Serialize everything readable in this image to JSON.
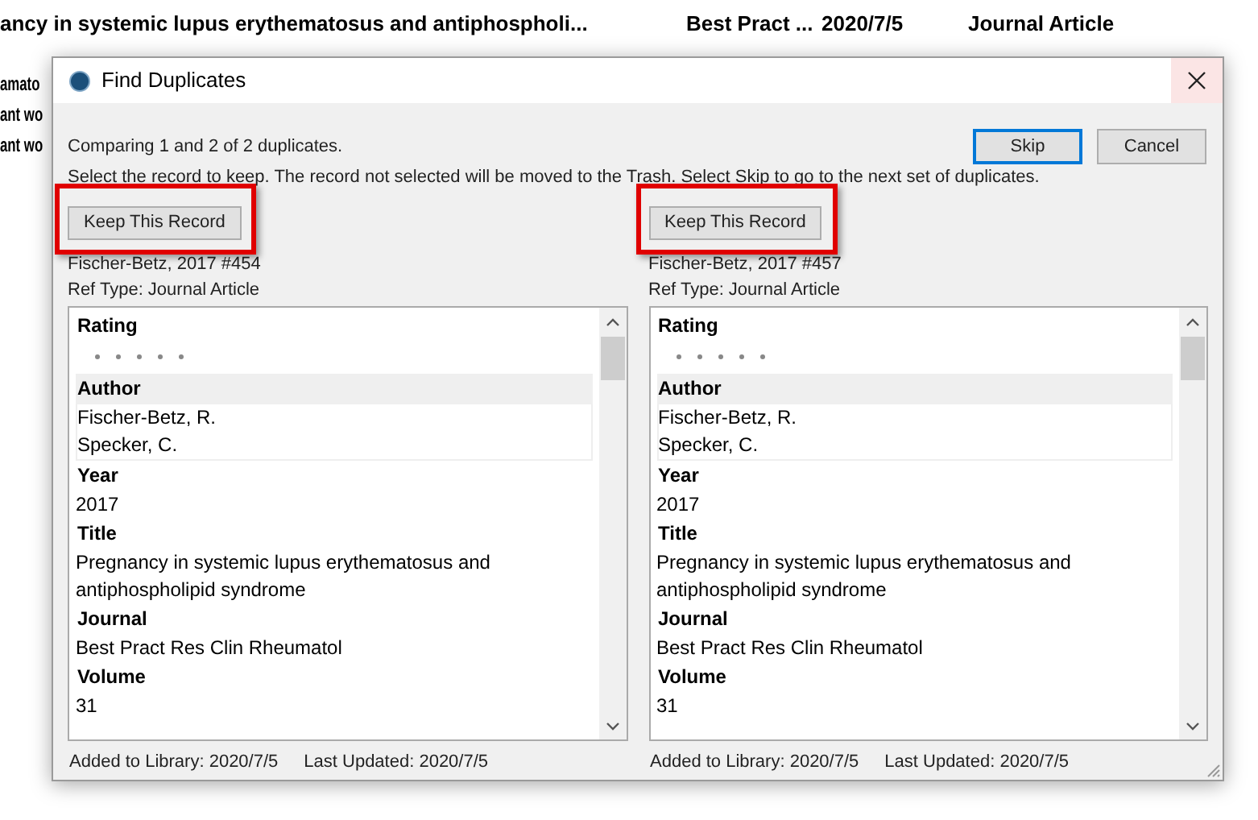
{
  "background_list": {
    "rows": [
      {
        "title": "ancy in systemic lupus erythematosus and antiphospholi...",
        "journal": "Best Pract ...",
        "date": "2020/7/5",
        "type": "Journal Article"
      },
      {
        "title": "amato"
      },
      {
        "title": "ant wo"
      },
      {
        "title": "ant wo"
      }
    ]
  },
  "window": {
    "title": "Find Duplicates"
  },
  "status": "Comparing 1 and 2 of 2 duplicates.",
  "instructions": "Select the record to keep. The record not selected will be moved to the Trash. Select Skip to go to the next set of duplicates.",
  "buttons": [
    {
      "label": "Skip",
      "focused": true
    },
    {
      "label": "Cancel",
      "focused": false
    }
  ],
  "records": [
    {
      "keep_button": "Keep This Record",
      "highlighted": true,
      "name": "Fischer-Betz, 2017 #454",
      "ref_type": "Ref Type: Journal Article",
      "fields": [
        {
          "kind": "rating",
          "label": "Rating",
          "selected": false
        },
        {
          "kind": "text",
          "label": "Author",
          "lines": [
            "Fischer-Betz, R.",
            "Specker, C."
          ],
          "selected": true
        },
        {
          "kind": "text",
          "label": "Year",
          "lines": [
            "2017"
          ],
          "selected": false
        },
        {
          "kind": "text",
          "label": "Title",
          "lines": [
            "Pregnancy in systemic lupus erythematosus and",
            "antiphospholipid syndrome"
          ],
          "selected": false
        },
        {
          "kind": "text",
          "label": "Journal",
          "lines": [
            "Best Pract Res Clin Rheumatol"
          ],
          "selected": false
        },
        {
          "kind": "text",
          "label": "Volume",
          "lines": [
            "31"
          ],
          "selected": false
        }
      ],
      "added": "Added to Library: 2020/7/5",
      "updated": "Last Updated: 2020/7/5"
    },
    {
      "keep_button": "Keep This Record",
      "highlighted": true,
      "name": "Fischer-Betz, 2017 #457",
      "ref_type": "Ref Type: Journal Article",
      "fields": [
        {
          "kind": "rating",
          "label": "Rating",
          "selected": false
        },
        {
          "kind": "text",
          "label": "Author",
          "lines": [
            "Fischer-Betz, R.",
            "Specker, C."
          ],
          "selected": true
        },
        {
          "kind": "text",
          "label": "Year",
          "lines": [
            "2017"
          ],
          "selected": false
        },
        {
          "kind": "text",
          "label": "Title",
          "lines": [
            "Pregnancy in systemic lupus erythematosus and",
            "antiphospholipid syndrome"
          ],
          "selected": false
        },
        {
          "kind": "text",
          "label": "Journal",
          "lines": [
            "Best Pract Res Clin Rheumatol"
          ],
          "selected": false
        },
        {
          "kind": "text",
          "label": "Volume",
          "lines": [
            "31"
          ],
          "selected": false
        }
      ],
      "added": "Added to Library: 2020/7/5",
      "updated": "Last Updated: 2020/7/5"
    }
  ]
}
